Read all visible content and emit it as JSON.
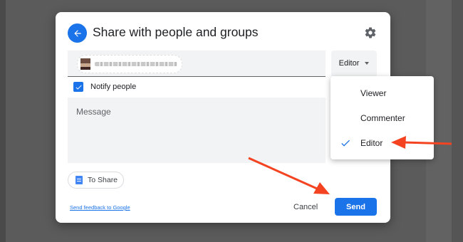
{
  "dialog": {
    "title": "Share with people and groups",
    "icons": {
      "back": "arrow-left-icon",
      "settings": "gear-icon"
    }
  },
  "people_field": {
    "chip_icon": "avatar"
  },
  "role": {
    "selected": "Editor",
    "caret_icon": "caret-down-icon"
  },
  "notify": {
    "label": "Notify people",
    "checked": true
  },
  "message": {
    "placeholder": "Message"
  },
  "attachment": {
    "label": "To Share",
    "icon": "google-docs-icon"
  },
  "footer": {
    "feedback_link": "Send feedback to Google",
    "cancel_label": "Cancel",
    "send_label": "Send"
  },
  "role_menu": {
    "items": [
      {
        "label": "Viewer",
        "checked": false
      },
      {
        "label": "Commenter",
        "checked": false
      },
      {
        "label": "Editor",
        "checked": true
      }
    ]
  },
  "colors": {
    "accent": "#1a73e8",
    "annotation_arrow": "#f44321"
  }
}
